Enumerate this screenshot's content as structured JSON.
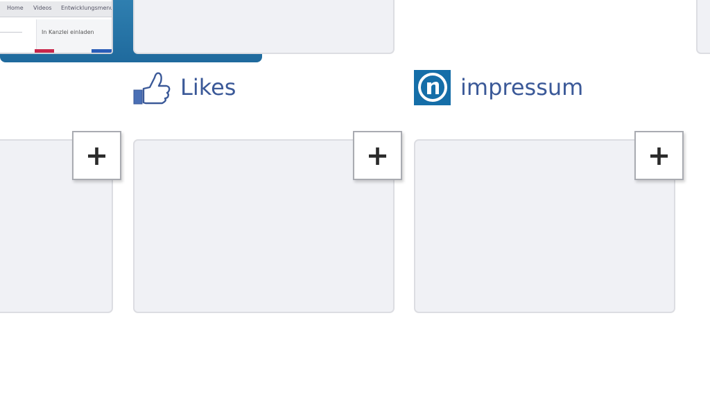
{
  "top_row": {
    "screenshot_tile": {
      "tabs": [
        "Home",
        "Videos",
        "Entwicklungsmenu"
      ],
      "text": "In Kanzlei einladen"
    },
    "impressum_banner": {
      "text": "impressum",
      "color": "#2a77aa"
    }
  },
  "apps": [
    {
      "label": "Likes",
      "icon": "thumbs-up-icon",
      "color": "#3b5998"
    },
    {
      "label": "impressum",
      "icon": "impressum-logo-icon",
      "color": "#3b5998"
    }
  ],
  "add_buttons": [
    {
      "label": "+"
    },
    {
      "label": "+"
    },
    {
      "label": "+"
    }
  ],
  "colors": {
    "tile_bg": "#f0f1f5",
    "link": "#3b5998",
    "impressum_blue": "#156ea8"
  }
}
